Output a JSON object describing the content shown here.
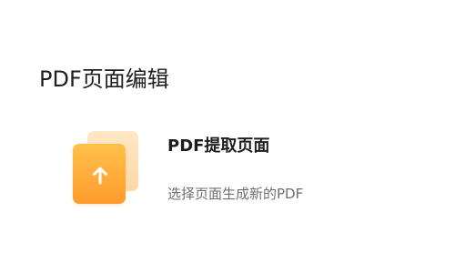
{
  "section": {
    "title": "PDF页面编辑"
  },
  "tool_card": {
    "title": "PDF提取页面",
    "description": "选择页面生成新的PDF",
    "icon": "upload-arrow-icon",
    "colors": {
      "icon_front_top": "#ffc14a",
      "icon_front_bottom": "#ff9b2f",
      "icon_back": "#ffe1b8"
    }
  }
}
